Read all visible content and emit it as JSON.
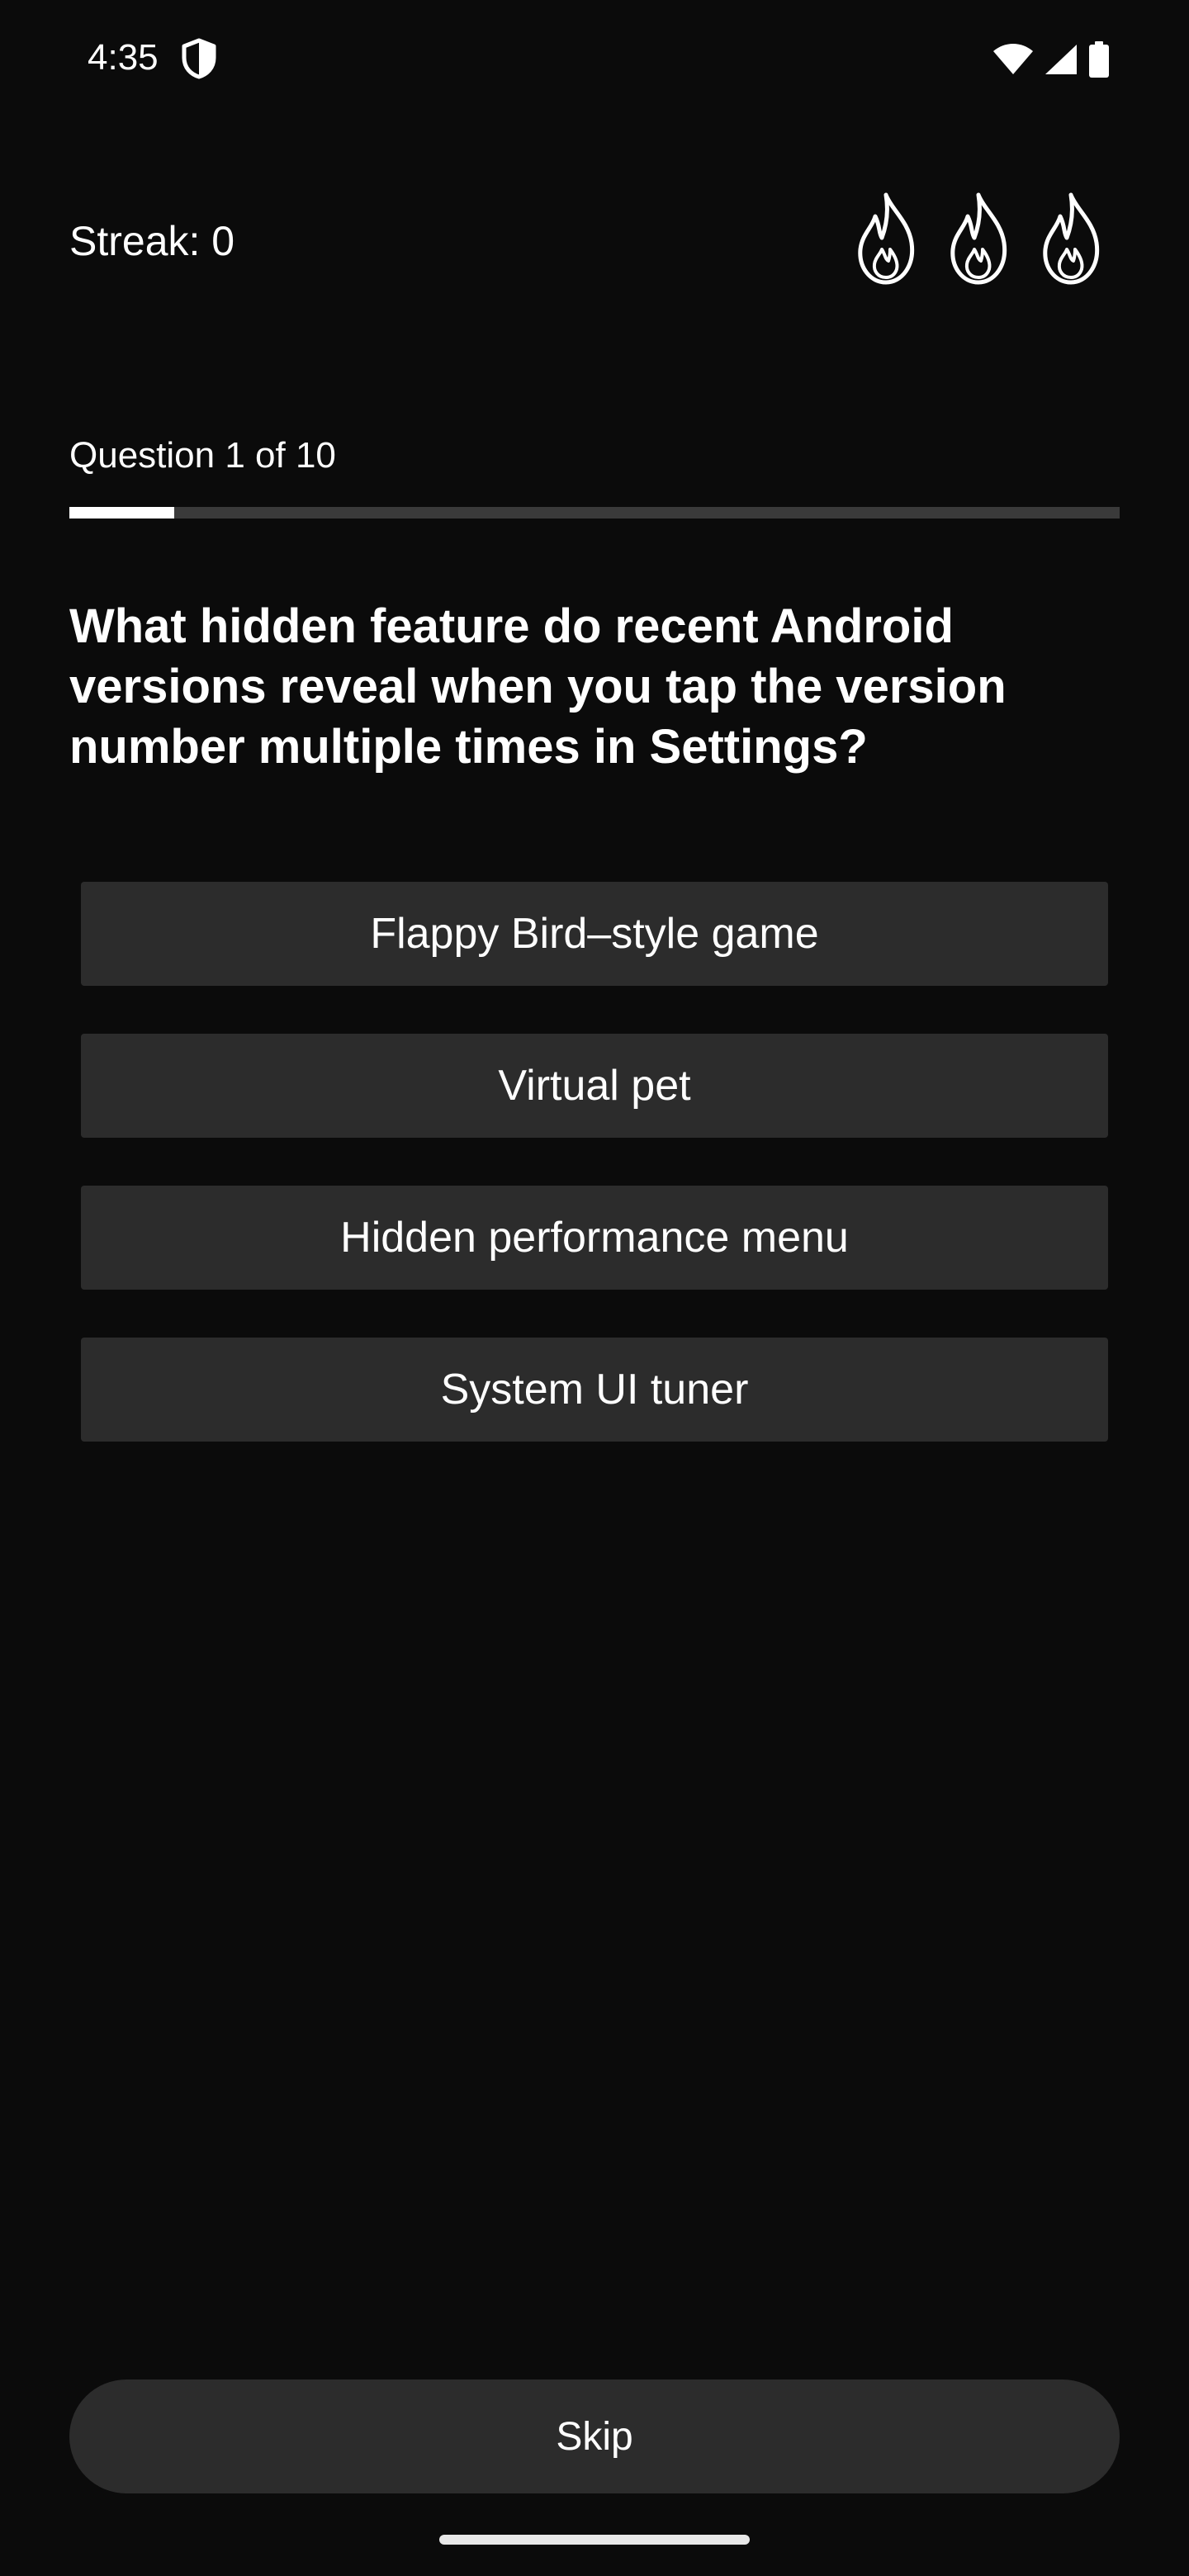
{
  "status_bar": {
    "time": "4:35",
    "icons": [
      "shield-icon",
      "wifi-icon",
      "cellular-signal-icon",
      "battery-icon"
    ]
  },
  "header": {
    "streak_label": "Streak: 0",
    "lives_icons": [
      "flame-icon",
      "flame-icon",
      "flame-icon"
    ]
  },
  "quiz": {
    "progress_label": "Question 1 of 10",
    "progress_fraction": 0.1,
    "question": "What hidden feature do recent Android versions reveal when you tap the version number multiple times in Settings?",
    "answers": [
      {
        "label": "Flappy Bird–style game"
      },
      {
        "label": "Virtual pet"
      },
      {
        "label": "Hidden performance menu"
      },
      {
        "label": "System UI tuner"
      }
    ]
  },
  "footer": {
    "skip_label": "Skip"
  },
  "colors": {
    "background": "#0b0b0b",
    "button": "#2c2c2c",
    "text": "#ffffff",
    "progress_track": "#3a3a3a",
    "progress_fill": "#ffffff"
  }
}
